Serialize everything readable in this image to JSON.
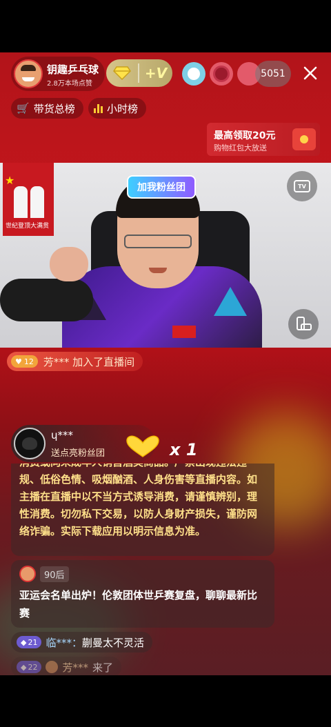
{
  "header": {
    "streamer_name": "钥趣乒乓球",
    "likes_text": "2.8万本场点赞",
    "viewer_count": "5051",
    "fan_badge": "+V"
  },
  "tabs": {
    "sales_rank": "带货总榜",
    "hourly_rank": "小时榜"
  },
  "promo": {
    "title": "最高领取20元",
    "subtitle": "购物红包大放送"
  },
  "video": {
    "fan_club_sticker": "加我粉丝团",
    "poster_text": "世纪登顶大满贯",
    "tv_label": "TV"
  },
  "join_notice": {
    "level": "12",
    "text": "芳*** 加入了直播间"
  },
  "gift": {
    "user": "ɥ***",
    "action": "送点亮粉丝团",
    "multiplier": "x 1"
  },
  "system_notice": {
    "text": "消费或向未成年人销售酒类商品。严禁出现违法违规、低俗色情、吸烟酗酒、人身伤害等直播内容。如主播在直播中以不当方式诱导消费，请谨慎辨别，理性消费。切勿私下交易，以防人身财产损失，谨防网络诈骗。实际下载应用以明示信息为准。"
  },
  "announcement": {
    "tag": "90后",
    "text": "亚运会名单出炉！伦敦团体世乒赛复盘，聊聊最新比赛"
  },
  "comments": [
    {
      "level": "21",
      "user": "临***：",
      "text": "蒯曼太不灵活"
    },
    {
      "level": "22",
      "user": "芳***",
      "text": "来了"
    }
  ],
  "colors": {
    "accent_yellow": "#ffe08a",
    "brand_red": "#c4161c",
    "level_purple": "#6d5bd0"
  }
}
